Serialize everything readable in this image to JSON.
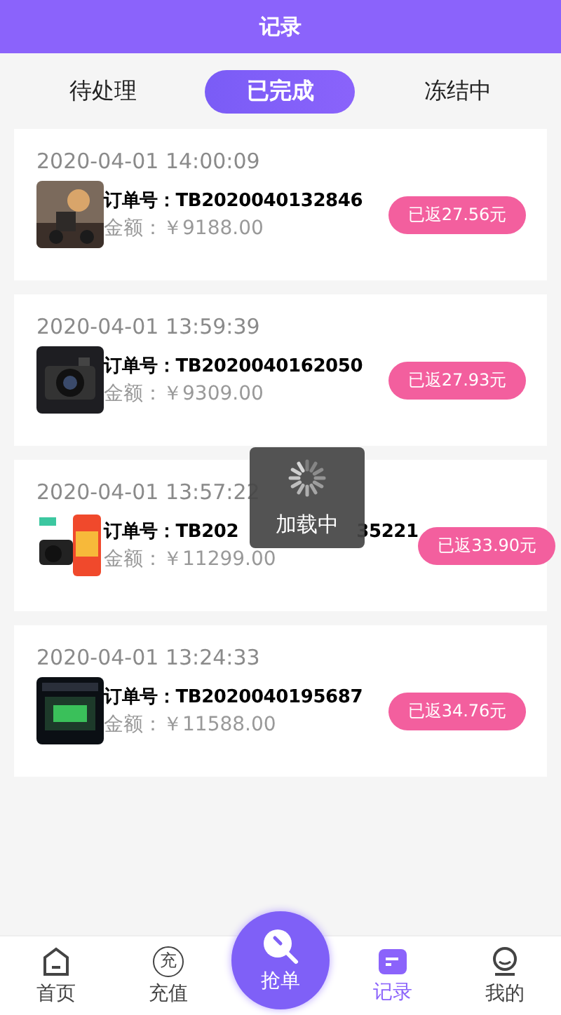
{
  "header": {
    "title": "记录"
  },
  "tabs": [
    {
      "label": "待处理",
      "selected": false
    },
    {
      "label": "已完成",
      "selected": true
    },
    {
      "label": "冻结中",
      "selected": false
    }
  ],
  "orders": [
    {
      "time": "2020-04-01 14:00:09",
      "order_label": "订单号：",
      "order_no": "TB2020040132846",
      "amount": "金额：￥9188.00",
      "rebate": "已返27.56元"
    },
    {
      "time": "2020-04-01 13:59:39",
      "order_label": "订单号：",
      "order_no": "TB2020040162050",
      "amount": "金额：￥9309.00",
      "rebate": "已返27.93元"
    },
    {
      "time": "2020-04-01 13:57:22",
      "order_label": "订单号：",
      "order_no": "TB202",
      "order_no_end": "35221",
      "amount": "金额：￥11299.00",
      "rebate": "已返33.90元"
    },
    {
      "time": "2020-04-01 13:24:33",
      "order_label": "订单号：",
      "order_no": "TB2020040195687",
      "amount": "金额：￥11588.00",
      "rebate": "已返34.76元"
    }
  ],
  "loading": {
    "text": "加载中"
  },
  "nav": [
    {
      "kind": "home",
      "label": "首页",
      "selected": false
    },
    {
      "kind": "recharge",
      "label": "充值",
      "glyph": "充",
      "selected": false
    },
    {
      "kind": "grab",
      "label": "抢单",
      "selected": false
    },
    {
      "kind": "record",
      "label": "记录",
      "selected": true
    },
    {
      "kind": "me",
      "label": "我的",
      "selected": false
    }
  ]
}
